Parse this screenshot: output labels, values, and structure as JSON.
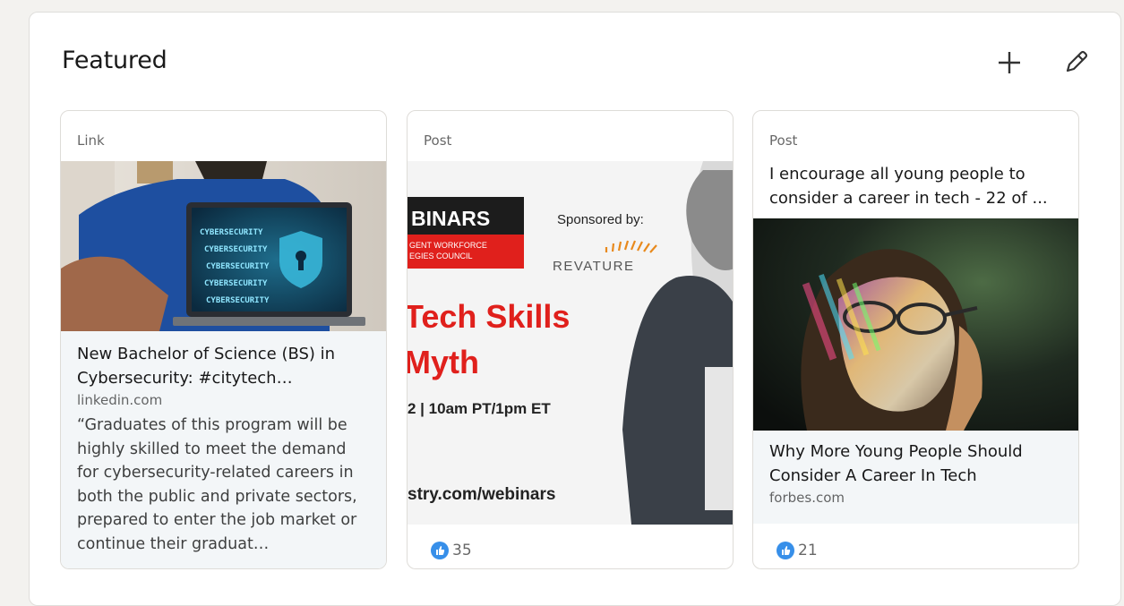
{
  "section": {
    "title": "Featured",
    "add_icon": "plus-icon",
    "edit_icon": "pencil-icon"
  },
  "cards": [
    {
      "type": "Link",
      "title": "New Bachelor of Science (BS) in Cybersecurity: #citytech…",
      "source": "linkedin.com",
      "description": "“Graduates of this program will be highly skilled to meet the demand for cybersecurity-related careers in both the public and private sectors, prepared to enter the job market or continue their graduat…",
      "image_text": [
        "CYBERSECURITY",
        "CYBERSECURITY",
        "CYBERSECURITY",
        "CYBERSECURITY",
        "CYBERSECURITY"
      ]
    },
    {
      "type": "Post",
      "reactions": "35",
      "image_text": {
        "webinars": "BINARS",
        "council_line1": "GENT WORKFORCE",
        "council_line2": "EGIES COUNCIL",
        "sponsored": "Sponsored by:",
        "sponsor": "REVATURE",
        "headline1": "Tech Skills",
        "headline2": "Myth",
        "time": "2 | 10am PT/1pm ET",
        "url": "stry.com/webinars"
      }
    },
    {
      "type": "Post",
      "headline": "I encourage all young people to consider a career in tech - 22 of ...",
      "title": "Why More Young People Should Consider A Career In Tech",
      "source": "forbes.com",
      "reactions": "21"
    }
  ],
  "colors": {
    "background": "#f3f2ef",
    "card_meta_bg": "#f3f6f8",
    "like_blue": "#378fe9",
    "promo_red": "#e0201c"
  }
}
